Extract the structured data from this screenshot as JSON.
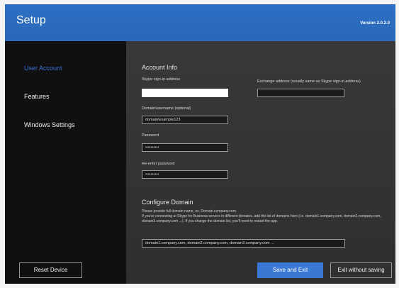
{
  "header": {
    "title": "Setup",
    "version": "Version 2.0.2.0"
  },
  "sidebar": {
    "items": [
      {
        "label": "User Account",
        "active": true
      },
      {
        "label": "Features",
        "active": false
      },
      {
        "label": "Windows Settings",
        "active": false
      }
    ],
    "reset_button": "Reset Device"
  },
  "account_info": {
    "title": "Account Info",
    "signin_label": "Skype sign-in address",
    "signin_value": "",
    "exchange_label": "Exchange address (usually same as Skype sign-in address)",
    "exchange_value": "",
    "domain_user_label": "Domain\\username (optional)",
    "domain_user_value": "domain\\example123",
    "password_label": "Password",
    "password_value": "••••••••••",
    "reenter_label": "Re-enter password",
    "reenter_value": "••••••••••"
  },
  "configure_domain": {
    "title": "Configure Domain",
    "description_line1": "Please provide full domain name, ex. Domain.company.com.",
    "description_line2": "If you're connecting to Skype for Business servers in different domains, add the list of domains here (i.e. domain1.company.com, domain2.company.com, domain3.company.com ...). If you change the domain list, you'll need to restart the app.",
    "domains_value": "domain1.company.com, domain2.company.com, domain3.company.com ..."
  },
  "footer": {
    "save_label": "Save and Exit",
    "exit_label": "Exit without saving"
  },
  "colors": {
    "accent": "#2c6fc4",
    "active_nav": "#3b6fd6",
    "primary_button": "#3a78d6"
  }
}
